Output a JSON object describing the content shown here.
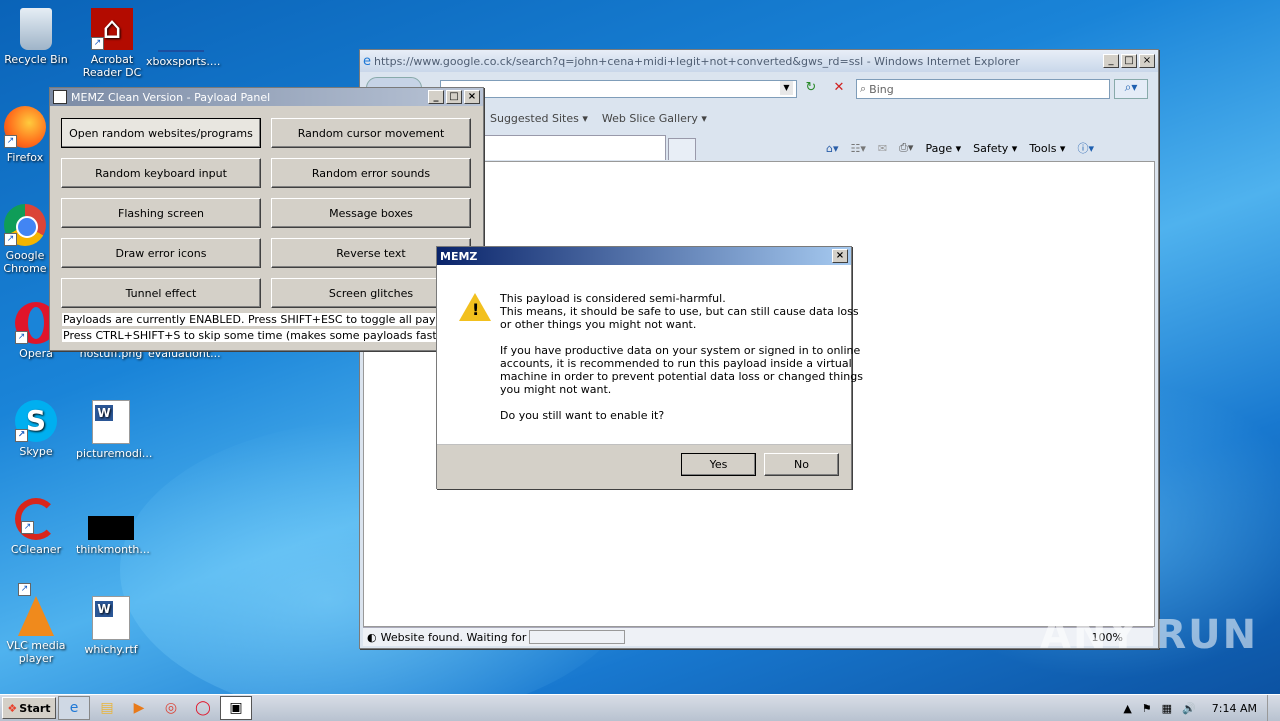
{
  "desktop": {
    "icons": [
      {
        "label": "Recycle Bin"
      },
      {
        "label": "Acrobat Reader DC"
      },
      {
        "label": "xboxsports...."
      },
      {
        "label": "Firefox"
      },
      {
        "label": "Google Chrome"
      },
      {
        "label": "Opera"
      },
      {
        "label": "nostuff.png"
      },
      {
        "label": "evaluationt..."
      },
      {
        "label": "Skype"
      },
      {
        "label": "picturemodi..."
      },
      {
        "label": "CCleaner"
      },
      {
        "label": "thinkmonth..."
      },
      {
        "label": "VLC media player"
      },
      {
        "label": "whichy.rtf"
      }
    ]
  },
  "ie": {
    "title": "https://www.google.co.ck/search?q=john+cena+midi+legit+not+converted&gws_rd=ssl - Windows Internet Explorer",
    "search_placeholder": "Bing",
    "favorites": [
      "Suggested Sites ▾",
      "Web Slice Gallery ▾"
    ],
    "commands": [
      "Page ▾",
      "Safety ▾",
      "Tools ▾"
    ],
    "status": "Website found. Waiting for re",
    "zoom": "100%"
  },
  "panel": {
    "title": "MEMZ Clean Version - Payload Panel",
    "buttons": [
      "Open random websites/programs",
      "Random cursor movement",
      "Random keyboard input",
      "Random error sounds",
      "Flashing screen",
      "Message boxes",
      "Draw error icons",
      "Reverse text",
      "Tunnel effect",
      "Screen glitches"
    ],
    "line1": "Payloads are currently ENABLED. Press SHIFT+ESC to toggle all payloads!",
    "line2": "Press CTRL+SHIFT+S to skip some time (makes some payloads faster)"
  },
  "dialog": {
    "title": "MEMZ",
    "lines": [
      "This payload is considered semi-harmful.",
      "This means, it should be safe to use, but can still cause data loss",
      "or other things you might not want.",
      "If you have productive data on your system or signed in to online",
      "accounts, it is recommended to run this payload inside a virtual",
      "machine in order to prevent potential data loss or changed things",
      "you might not want.",
      "Do you still want to enable it?"
    ],
    "yes": "Yes",
    "no": "No"
  },
  "taskbar": {
    "start": "Start",
    "clock": "7:14 AM"
  },
  "watermark": "ANY RUN"
}
